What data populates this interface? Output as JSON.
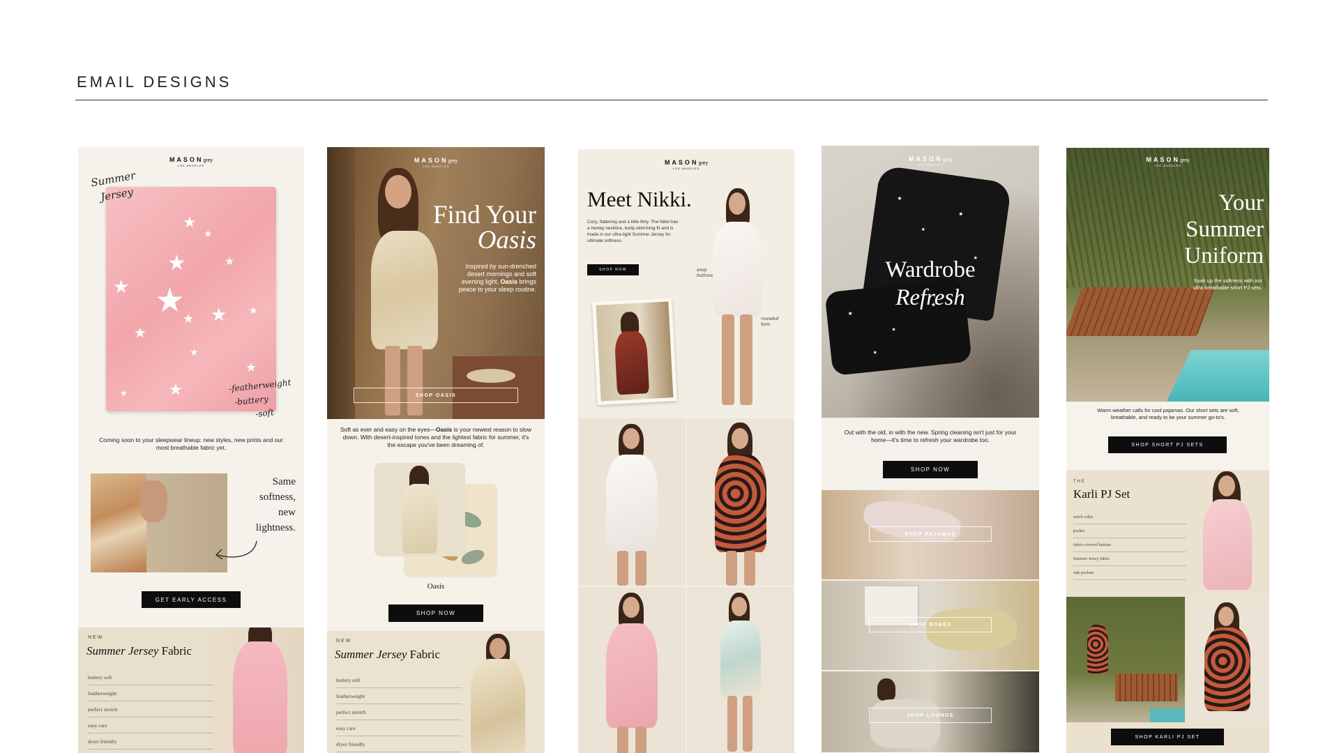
{
  "header": {
    "title": "EMAIL DESIGNS"
  },
  "colors": {
    "accent_black": "#0d0d0d",
    "cream": "#f4f0e8",
    "blush": "#f3aeb4",
    "sand": "#e8dcc7"
  },
  "email1": {
    "logo": "MASON",
    "logo_suffix": "grey",
    "logo_sub": "LOS ANGELES",
    "handwriting_top": [
      "Summer",
      "Jersey"
    ],
    "handwriting_notes": [
      "-featherweight",
      "-buttery",
      "-soft"
    ],
    "body": "Coming soon to your sleepwear lineup: new styles, new prints and our most breathable fabric yet.",
    "side_copy": [
      "Same",
      "softness,",
      "new",
      "lightness."
    ],
    "cta": "GET EARLY ACCESS",
    "fabric_eyebrow": "NEW",
    "fabric_title_italic": "Summer Jersey",
    "fabric_title_rest": " Fabric",
    "features": [
      "buttery soft",
      "featherweight",
      "perfect stretch",
      "easy care",
      "dryer friendly"
    ]
  },
  "email2": {
    "logo": "MASON",
    "logo_suffix": "grey",
    "logo_sub": "LOS ANGELES",
    "headline_1": "Find Your",
    "headline_2": "Oasis",
    "sub_1": "Inspired by sun-drenched",
    "sub_2": "desert mornings and soft",
    "sub_3a": "evening light, ",
    "sub_3b": "Oasis",
    "sub_3c": " brings",
    "sub_4": "peace to your sleep routine.",
    "hero_cta": "SHOP OASIS",
    "body_1": "Soft as ever and easy on the eyes—",
    "body_bold": "Oasis",
    "body_2": " is your newest reason to slow down. With desert-inspired tones and the lightest fabric for summer, it's the escape you've been dreaming of.",
    "product_label": "Oasis",
    "cta": "SHOP NOW",
    "fabric_eyebrow": "NEW",
    "fabric_title_italic": "Summer Jersey",
    "fabric_title_rest": " Fabric",
    "features": [
      "buttery soft",
      "featherweight",
      "perfect stretch",
      "easy care",
      "dryer friendly"
    ]
  },
  "email3": {
    "logo": "MASON",
    "logo_suffix": "grey",
    "logo_sub": "LOS ANGELES",
    "headline": "Meet Nikki.",
    "body": "Cozy, flattering and a little flirty. The Nikki has a henley neckline, body-skimming fit and is made in our ultra-light Summer Jersey for ultimate softness.",
    "cta": "SHOP NOW",
    "note_1": "snap buttons",
    "note_2": "rounded hem"
  },
  "email4": {
    "logo": "MASON",
    "logo_suffix": "grey",
    "logo_sub": "LOS ANGELES",
    "headline_1": "Wardrobe",
    "headline_2": "Refresh",
    "body": "Out with the old, in with the new. Spring cleaning isn't just for your home—it's time to refresh your wardrobe too.",
    "cta": "SHOP NOW",
    "tiles": [
      "SHOP PAJAMAS",
      "SHOP ROBES",
      "SHOP LOUNGE"
    ]
  },
  "email5": {
    "logo": "MASON",
    "logo_suffix": "grey",
    "logo_sub": "LOS ANGELES",
    "headline": [
      "Your",
      "Summer",
      "Uniform"
    ],
    "sub_1": "Soak up the softness with our",
    "sub_2": "ultra breathable short PJ sets.",
    "body": "Warm weather calls for cool pajamas. Our short sets are soft, breathable, and ready to be your summer go-to's.",
    "cta": "SHOP SHORT PJ SETS",
    "product_eyebrow": "THE",
    "product_title": "Karli PJ Set",
    "features": [
      "notch collar",
      "pocket",
      "fabric-covered buttons",
      "Summer Jersey fabric",
      "side pockets"
    ],
    "cta_2": "SHOP KARLI PJ SET"
  }
}
